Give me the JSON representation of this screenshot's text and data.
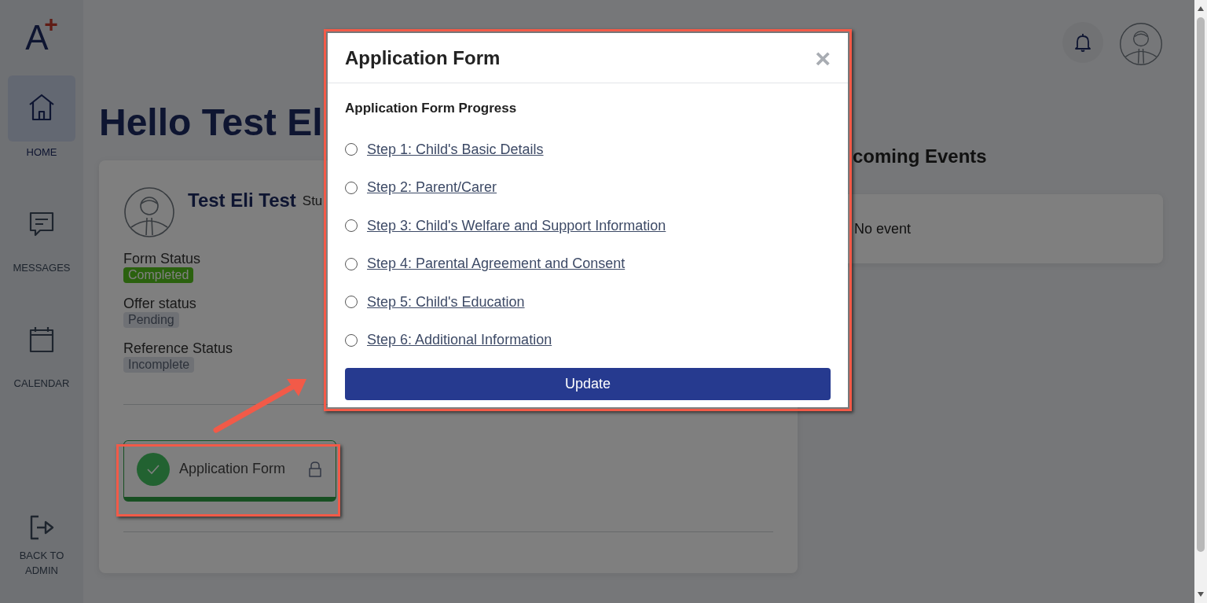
{
  "sidebar": {
    "logo": {
      "letter": "A",
      "mark": "+"
    },
    "items": [
      {
        "label": "HOME",
        "selected": true
      },
      {
        "label": "MESSAGES",
        "selected": false
      },
      {
        "label": "CALENDAR",
        "selected": false
      }
    ],
    "footer_item": {
      "label": "BACK TO ADMIN"
    }
  },
  "page": {
    "title": "Hello Test El",
    "student": {
      "name": "Test Eli Test",
      "role": "Stu",
      "statuses": [
        {
          "label": "Form Status",
          "badge": "Completed",
          "kind": "success"
        },
        {
          "label": "Offer status",
          "badge": "Pending",
          "kind": "neutral"
        },
        {
          "label": "Reference Status",
          "badge": "Incomplete",
          "kind": "neutral"
        }
      ],
      "forms": [
        {
          "label": "Application Form",
          "completed": true,
          "locked": true
        }
      ]
    },
    "events": {
      "title": "coming Events",
      "empty_text": "No event"
    }
  },
  "modal": {
    "title": "Application Form",
    "close": "×",
    "section_title": "Application Form Progress",
    "steps": [
      {
        "label": "Step 1: Child's Basic Details",
        "selected": false
      },
      {
        "label": "Step 2: Parent/Carer",
        "selected": false
      },
      {
        "label": "Step 3: Child's Welfare and Support Information",
        "selected": false
      },
      {
        "label": "Step 4: Parental Agreement and Consent",
        "selected": false
      },
      {
        "label": "Step 5: Child's Education",
        "selected": false
      },
      {
        "label": "Step 6: Additional Information",
        "selected": false
      }
    ],
    "button": "Update"
  }
}
